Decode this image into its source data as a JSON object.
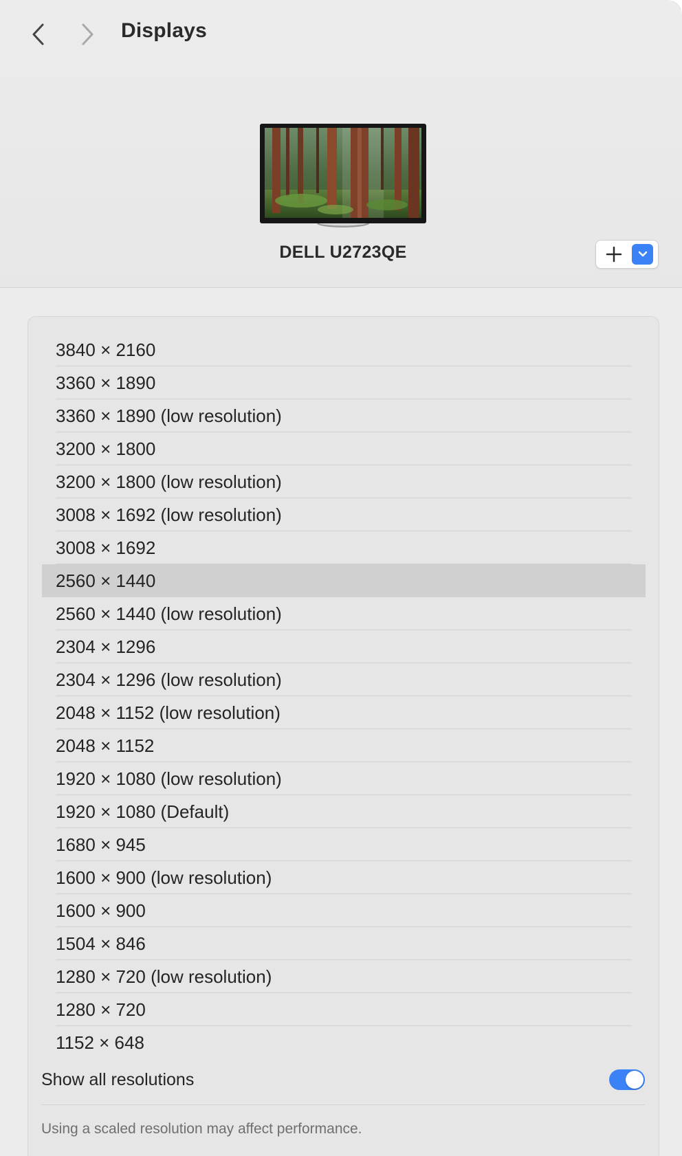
{
  "header": {
    "title": "Displays",
    "display_name": "DELL U2723QE"
  },
  "icons": {
    "back": "chevron-left-icon",
    "forward": "chevron-right-icon",
    "add": "plus-icon",
    "menu": "chevron-down-icon"
  },
  "colors": {
    "accent": "#3b82f6",
    "selected_row": "#d0d0d0",
    "panel": "#e6e6e6"
  },
  "resolutions": [
    {
      "label": "3840 × 2160",
      "selected": false
    },
    {
      "label": "3360 × 1890",
      "selected": false
    },
    {
      "label": "3360 × 1890 (low resolution)",
      "selected": false
    },
    {
      "label": "3200 × 1800",
      "selected": false
    },
    {
      "label": "3200 × 1800 (low resolution)",
      "selected": false
    },
    {
      "label": "3008 × 1692 (low resolution)",
      "selected": false
    },
    {
      "label": "3008 × 1692",
      "selected": false
    },
    {
      "label": "2560 × 1440",
      "selected": true
    },
    {
      "label": "2560 × 1440 (low resolution)",
      "selected": false
    },
    {
      "label": "2304 × 1296",
      "selected": false
    },
    {
      "label": "2304 × 1296 (low resolution)",
      "selected": false
    },
    {
      "label": "2048 × 1152 (low resolution)",
      "selected": false
    },
    {
      "label": "2048 × 1152",
      "selected": false
    },
    {
      "label": "1920 × 1080 (low resolution)",
      "selected": false
    },
    {
      "label": "1920 × 1080 (Default)",
      "selected": false
    },
    {
      "label": "1680 × 945",
      "selected": false
    },
    {
      "label": "1600 × 900 (low resolution)",
      "selected": false
    },
    {
      "label": "1600 × 900",
      "selected": false
    },
    {
      "label": "1504 × 846",
      "selected": false
    },
    {
      "label": "1280 × 720 (low resolution)",
      "selected": false
    },
    {
      "label": "1280 × 720",
      "selected": false
    },
    {
      "label": "1152 × 648",
      "selected": false
    }
  ],
  "show_all": {
    "label": "Show all resolutions",
    "enabled": true
  },
  "footnote": "Using a scaled resolution may affect performance."
}
